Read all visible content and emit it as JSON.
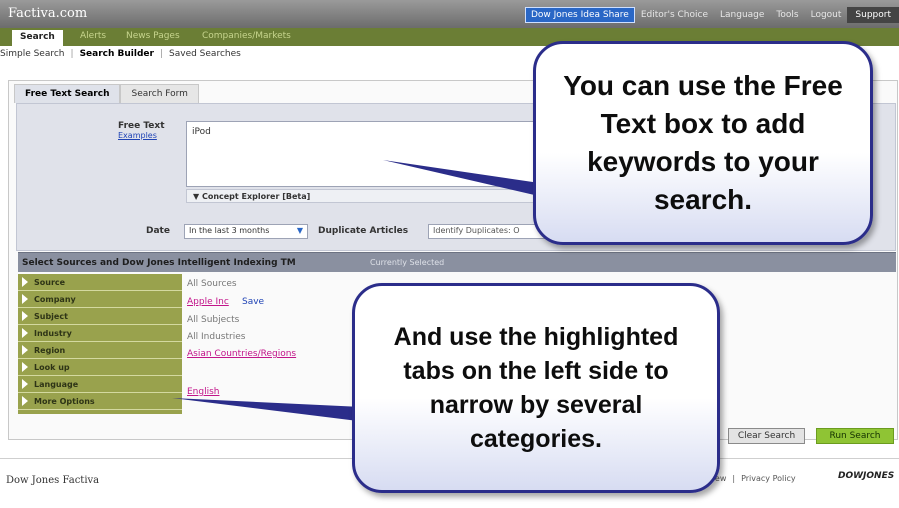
{
  "header": {
    "logo": "Factiva.com",
    "top_links": [
      "Dow Jones Idea Share",
      "Editor's Choice",
      "Language",
      "Tools",
      "Logout"
    ],
    "support": "Support"
  },
  "nav": {
    "tabs": [
      "Search",
      "Alerts",
      "News Pages",
      "Companies/Markets"
    ]
  },
  "subnav": {
    "simple": "Simple Search",
    "builder": "Search Builder",
    "saved": "Saved Searches"
  },
  "search_tabs": [
    "Free Text Search",
    "Search Form"
  ],
  "free_text": {
    "label": "Free Text",
    "examples": "Examples",
    "value": "iPod",
    "concept": "Concept Explorer [Beta]"
  },
  "date": {
    "label": "Date",
    "value": "In the last 3 months"
  },
  "duplicate": {
    "label": "Duplicate Articles",
    "value": "Identify Duplicates: O"
  },
  "sources_bar": {
    "heading": "Select Sources and Dow Jones Intelligent Indexing TM",
    "currently": "Currently Selected"
  },
  "categories": [
    {
      "name": "Source",
      "value": "All Sources",
      "linked": false
    },
    {
      "name": "Company",
      "value": "Apple Inc",
      "linked": true
    },
    {
      "name": "Subject",
      "value": "All Subjects",
      "linked": false
    },
    {
      "name": "Industry",
      "value": "All Industries",
      "linked": false
    },
    {
      "name": "Region",
      "value": "Asian Countries/Regions",
      "linked": true
    },
    {
      "name": "Look up",
      "value": "",
      "linked": false
    },
    {
      "name": "Language",
      "value": "English",
      "linked": true
    },
    {
      "name": "More Options",
      "value": "",
      "linked": false
    }
  ],
  "save_link": "Save",
  "buttons": {
    "clear": "Clear Search",
    "run": "Run Search"
  },
  "footer": {
    "logo": "Dow Jones Factiva",
    "links": [
      "'s New",
      "Privacy Policy"
    ],
    "brand": "DOWJONES"
  },
  "callouts": {
    "top": "You can use the Free Text box to add keywords to your search.",
    "bottom": "And use the highlighted tabs on the left side to narrow by several categories."
  }
}
